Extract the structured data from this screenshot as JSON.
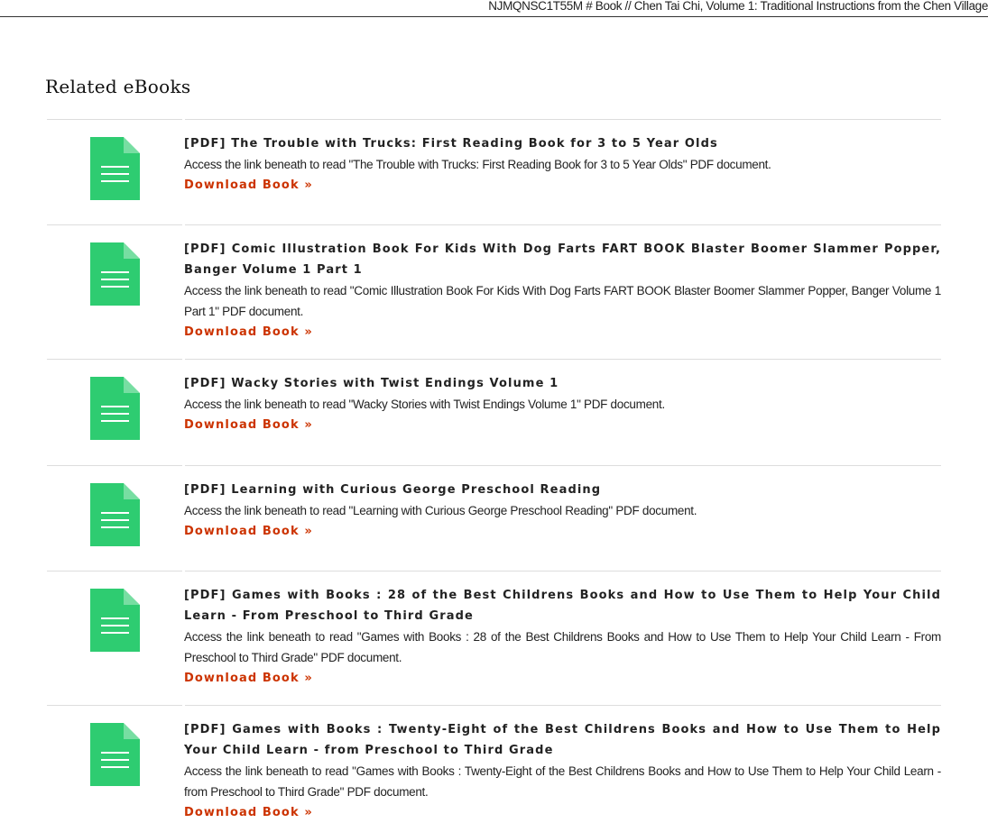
{
  "header": {
    "breadcrumb": "NJMQNSC1T55M # Book // Chen Tai Chi, Volume 1: Traditional Instructions from the Chen Village"
  },
  "section": {
    "title": "Related eBooks"
  },
  "colors": {
    "icon_green": "#2ecc71",
    "link": "#cc3300"
  },
  "items": [
    {
      "title": "[PDF] The Trouble with Trucks: First Reading Book for 3 to 5 Year Olds",
      "description": "Access the link beneath to read \"The Trouble with Trucks: First Reading Book for 3 to 5 Year Olds\" PDF document.",
      "link": "Download Book »",
      "icon": "document-icon"
    },
    {
      "title": "[PDF] Comic Illustration Book For Kids With Dog Farts FART BOOK Blaster Boomer Slammer Popper, Banger Volume 1 Part 1",
      "description": "Access the link beneath to read \"Comic Illustration Book For Kids With Dog Farts FART BOOK Blaster Boomer Slammer Popper, Banger Volume 1 Part 1\" PDF document.",
      "link": "Download Book »",
      "icon": "document-icon"
    },
    {
      "title": "[PDF] Wacky Stories with Twist Endings Volume 1",
      "description": "Access the link beneath to read \"Wacky Stories with Twist Endings Volume 1\" PDF document.",
      "link": "Download Book »",
      "icon": "document-icon"
    },
    {
      "title": "[PDF] Learning with Curious George Preschool Reading",
      "description": "Access the link beneath to read \"Learning with Curious George Preschool Reading\" PDF document.",
      "link": "Download Book »",
      "icon": "document-icon"
    },
    {
      "title": "[PDF] Games with Books : 28 of the Best Childrens Books and How to Use Them to Help Your Child Learn - From Preschool to Third Grade",
      "description": "Access the link beneath to read \"Games with Books : 28 of the Best Childrens Books and How to Use Them to Help Your Child Learn - From Preschool to Third Grade\" PDF document.",
      "link": "Download Book »",
      "icon": "document-icon"
    },
    {
      "title": "[PDF] Games with Books : Twenty-Eight of the Best Childrens Books and How to Use Them to Help Your Child Learn - from Preschool to Third Grade",
      "description": "Access the link beneath to read \"Games with Books : Twenty-Eight of the Best Childrens Books and How to Use Them to Help Your Child Learn - from Preschool to Third Grade\" PDF document.",
      "link": "Download Book »",
      "icon": "document-icon"
    }
  ]
}
